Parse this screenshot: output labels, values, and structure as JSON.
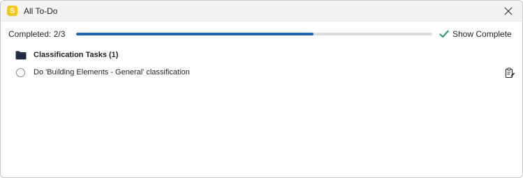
{
  "window": {
    "app_icon_letter": "S",
    "title": "All To-Do"
  },
  "progress": {
    "label": "Completed: 2/3",
    "completed": 2,
    "total": 3,
    "fraction": 0.667
  },
  "toolbar": {
    "show_complete_label": "Show Complete"
  },
  "group": {
    "label": "Classification Tasks (1)"
  },
  "tasks": [
    {
      "text": "Do 'Building Elements - General' classification",
      "done": false
    }
  ],
  "colors": {
    "accent": "#1f63b5",
    "check": "#22a06b",
    "app_icon": "#f5c518"
  },
  "icons": {
    "app": "app-logo-icon",
    "close": "close-icon",
    "check": "check-icon",
    "folder": "folder-icon",
    "task_action": "clipboard-edit-icon"
  }
}
